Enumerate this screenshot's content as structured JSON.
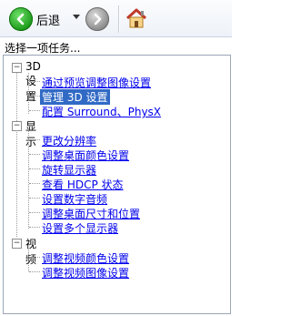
{
  "toolbar": {
    "back_label": "后退"
  },
  "task_title": "选择一项任务...",
  "tree": {
    "categories": [
      {
        "label": "3D 设置",
        "items": [
          {
            "label": "通过预览调整图像设置",
            "selected": false
          },
          {
            "label": "管理 3D 设置",
            "selected": true
          },
          {
            "label": "配置 Surround、PhysX",
            "selected": false
          }
        ]
      },
      {
        "label": "显示",
        "items": [
          {
            "label": "更改分辨率"
          },
          {
            "label": "调整桌面颜色设置"
          },
          {
            "label": "旋转显示器"
          },
          {
            "label": "查看 HDCP 状态"
          },
          {
            "label": "设置数字音频"
          },
          {
            "label": "调整桌面尺寸和位置"
          },
          {
            "label": "设置多个显示器"
          }
        ]
      },
      {
        "label": "视频",
        "items": [
          {
            "label": "调整视频颜色设置"
          },
          {
            "label": "调整视频图像设置"
          }
        ]
      }
    ]
  },
  "colors": {
    "link": "#0000ee",
    "selection": "#316ac5",
    "panel_border": "#9aa6b8"
  }
}
